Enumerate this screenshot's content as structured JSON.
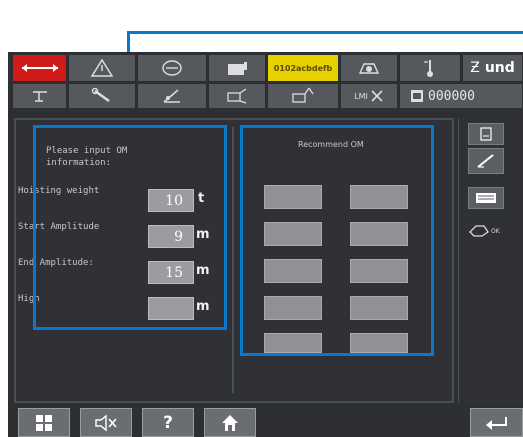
{
  "toolbar": {
    "row1_badge_text": "0102acbdefb",
    "und_text": "und",
    "row2_lmi_label": "LMI",
    "row2_code": "000000"
  },
  "input_panel": {
    "heading_line1": "Please input OM",
    "heading_line2": "information:",
    "rows": [
      {
        "label": "Hoisting weight",
        "value": "10",
        "unit": "t"
      },
      {
        "label": "Start Amplitude",
        "value": "9",
        "unit": "m"
      },
      {
        "label": "End Amplitude:",
        "value": "15",
        "unit": "m"
      },
      {
        "label": "High",
        "value": "",
        "unit": "m"
      }
    ]
  },
  "recommend_panel": {
    "title": "Recommend OM"
  },
  "side_panel": {
    "ok_label": "OK"
  },
  "bottom_bar": {
    "help_label": "?"
  },
  "colors": {
    "callout": "#0b78c9",
    "screen_bg": "#2d2f33",
    "toolbar_button": "#55585d",
    "alarm_red": "#d11b1b",
    "badge_yellow": "#e6d100",
    "input_field": "#9a9ca1"
  }
}
